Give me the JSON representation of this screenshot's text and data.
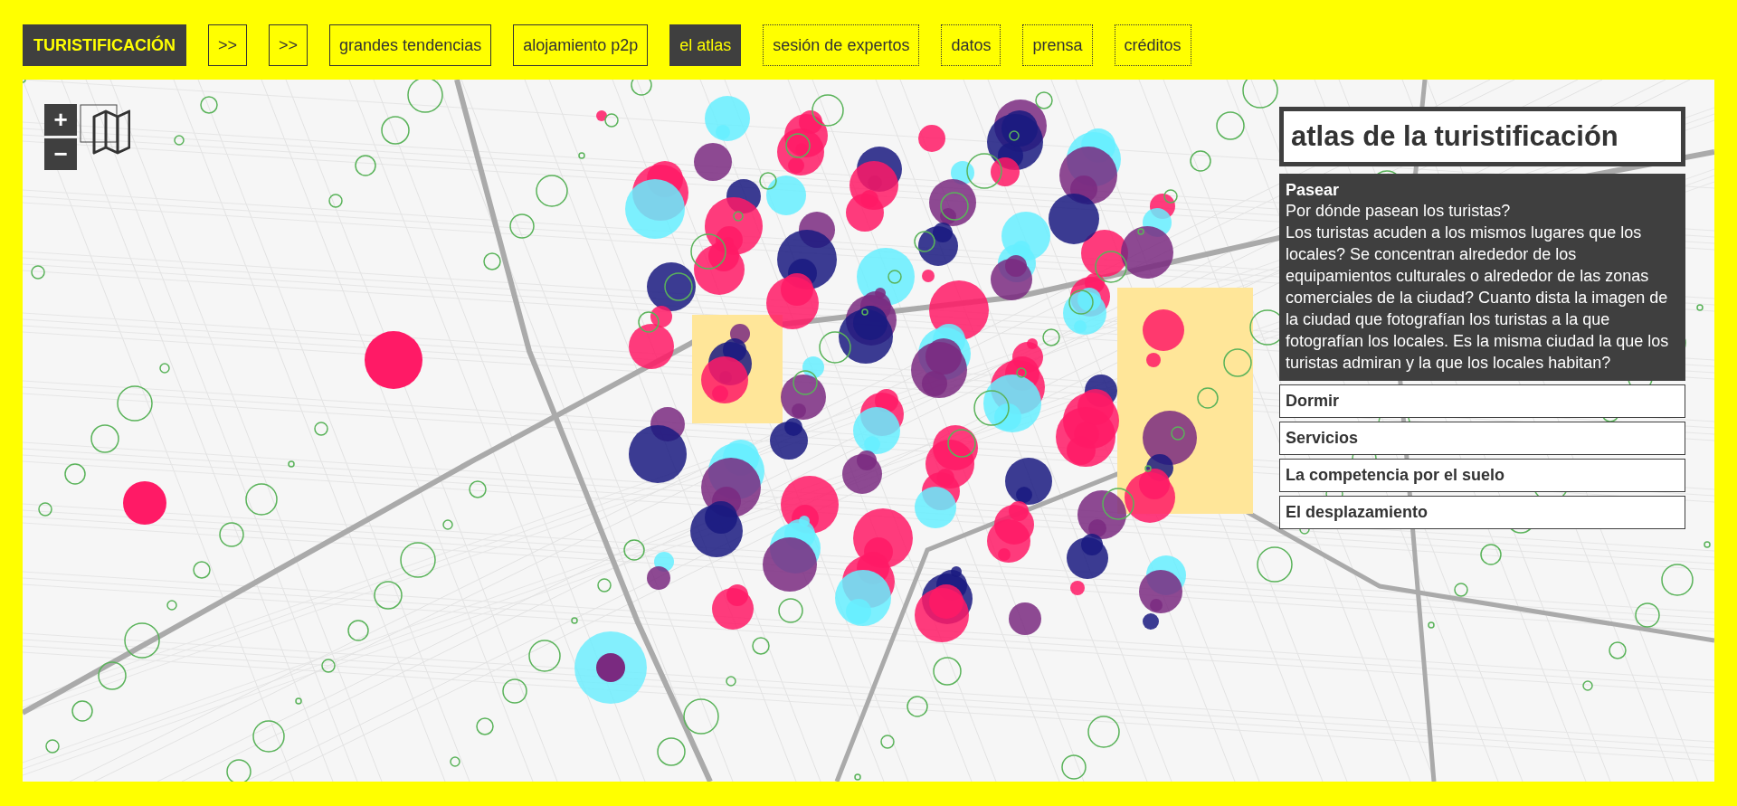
{
  "nav": {
    "brand": "TURISTIFICACIÓN",
    "items": [
      {
        "label": ">>",
        "selected": false,
        "kind": "solid"
      },
      {
        "label": ">>",
        "selected": false,
        "kind": "solid"
      },
      {
        "label": "grandes tendencias",
        "selected": false,
        "kind": "solid"
      },
      {
        "label": "alojamiento p2p",
        "selected": false,
        "kind": "solid"
      },
      {
        "label": "el atlas",
        "selected": true,
        "kind": "solid"
      },
      {
        "label": "sesión de expertos",
        "selected": false,
        "kind": "dotted"
      },
      {
        "label": "datos",
        "selected": false,
        "kind": "dotted"
      },
      {
        "label": "prensa",
        "selected": false,
        "kind": "dotted"
      },
      {
        "label": "créditos",
        "selected": false,
        "kind": "dotted"
      }
    ]
  },
  "map": {
    "zoom_in": "+",
    "zoom_out": "−"
  },
  "panel": {
    "title": "atlas de la turistificación",
    "sections": [
      {
        "title": "Pasear",
        "selected": true,
        "subtitle": "Por dónde pasean los turistas?",
        "description": "Los turistas acuden a los mismos lugares que los locales? Se concentran alrededor de los equipamientos culturales o alrededor de las zonas comerciales de la ciudad? Cuanto dista la imagen de la ciudad que fotografían los turistas a la que fotografían los locales. Es la misma ciudad la que los turistas admiran y la que los locales habitan?"
      },
      {
        "title": "Dormir",
        "selected": false
      },
      {
        "title": "Servicios",
        "selected": false
      },
      {
        "title": "La competencia por el suelo",
        "selected": false
      },
      {
        "title": "El desplazamiento",
        "selected": false
      }
    ]
  }
}
